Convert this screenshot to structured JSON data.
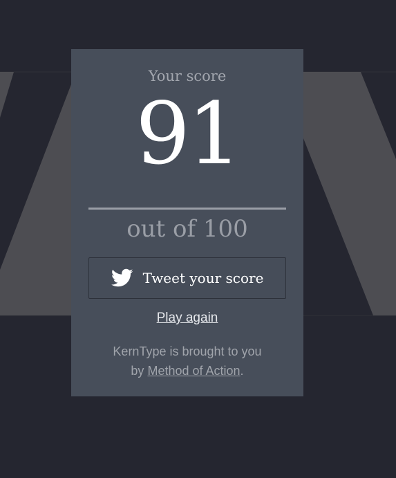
{
  "background": {
    "color": "#252630",
    "glyph_color": "#4d4d52"
  },
  "card": {
    "color": "#474e5a"
  },
  "score": {
    "label": "Your score",
    "value": "91",
    "max_label": "out of 100"
  },
  "tweet_button": {
    "label": "Tweet your score",
    "icon": "twitter-bird-icon"
  },
  "play_again": {
    "label": "Play again"
  },
  "credit": {
    "line1": "KernType is brought to you",
    "prefix": "by",
    "link_text": "Method of Action",
    "suffix": "."
  }
}
